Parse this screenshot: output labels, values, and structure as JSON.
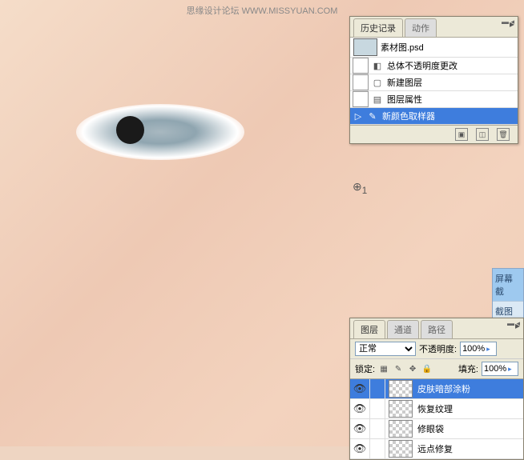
{
  "watermark": "思缘设计论坛   WWW.MISSYUAN.COM",
  "cursor_label": "1",
  "history": {
    "tabs": {
      "active": "历史记录",
      "inactive": "动作"
    },
    "first_item": "素材图.psd",
    "items": [
      {
        "icon": "◧",
        "text": "总体不透明度更改"
      },
      {
        "icon": "▢",
        "text": "新建图层"
      },
      {
        "icon": "▤",
        "text": "图层属性"
      },
      {
        "icon": "✎",
        "text": "新颜色取样器",
        "selected": true
      }
    ]
  },
  "side": {
    "a": "屏幕截",
    "b": "截图时"
  },
  "layers": {
    "tabs": {
      "t1": "图层",
      "t2": "通道",
      "t3": "路径"
    },
    "blend_label": "正常",
    "opacity_label": "不透明度:",
    "opacity_val": "100%",
    "lock_label": "锁定:",
    "fill_label": "填充:",
    "fill_val": "100%",
    "rows": [
      {
        "name": "皮肤暗部涂粉",
        "selected": true
      },
      {
        "name": "恢复纹理"
      },
      {
        "name": "修眼袋"
      },
      {
        "name": "远点修复"
      }
    ]
  }
}
